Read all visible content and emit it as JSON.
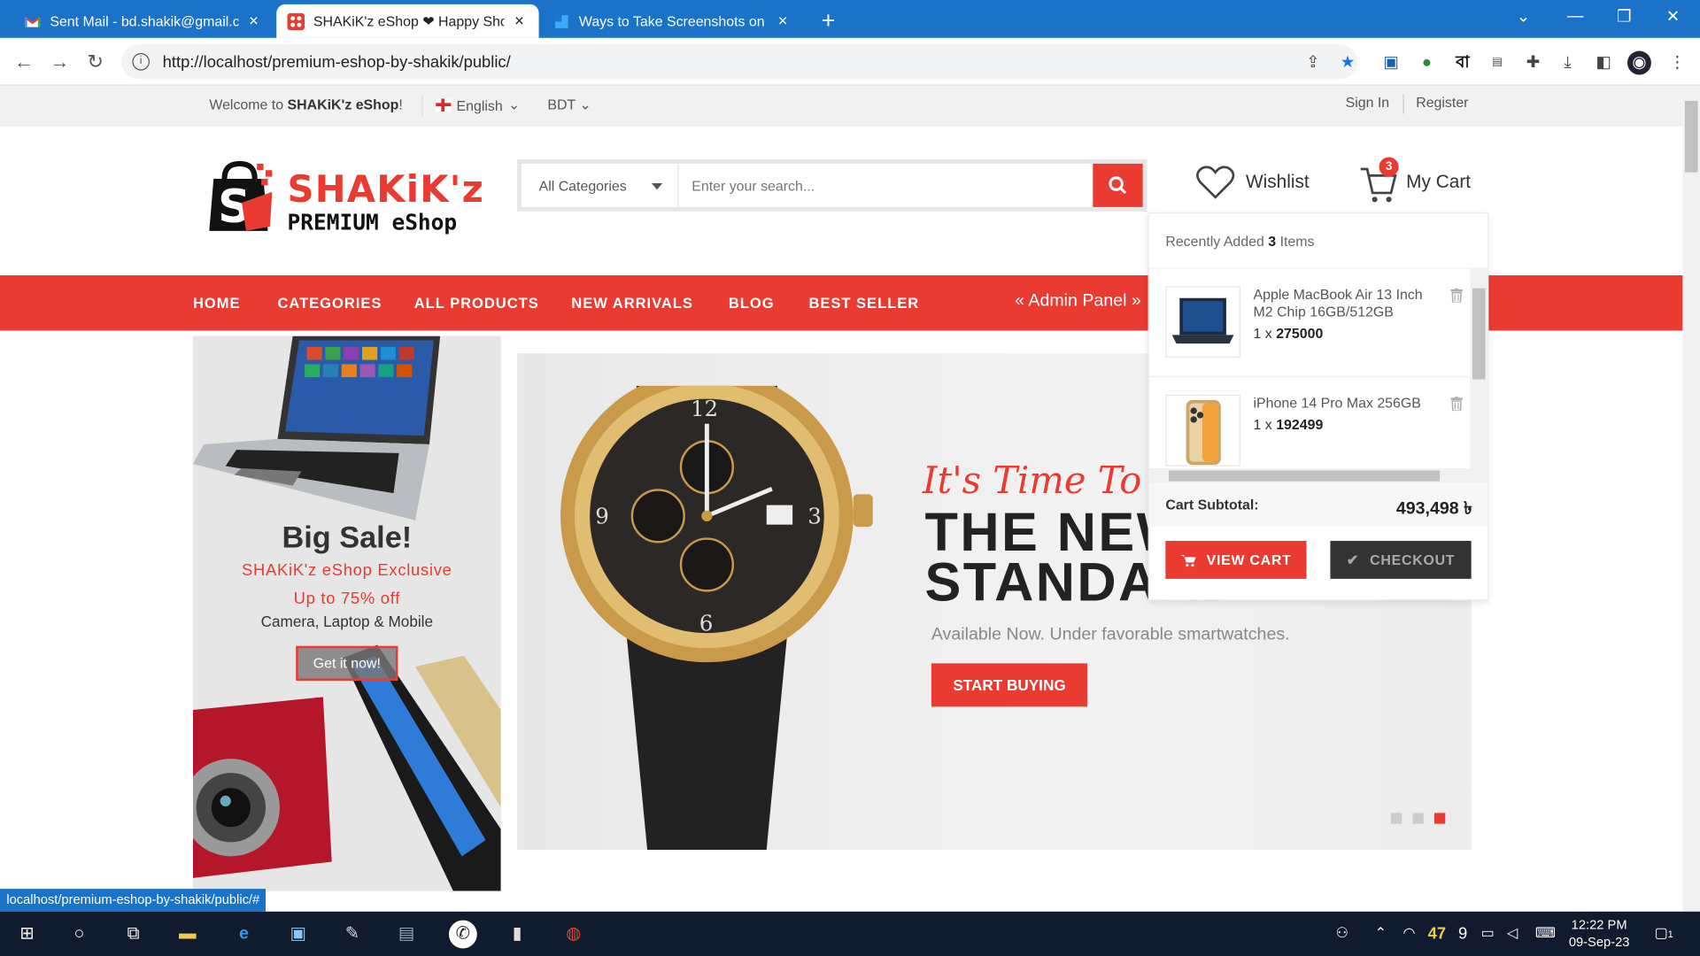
{
  "browser": {
    "tabs": [
      {
        "title": "Sent Mail - bd.shakik@gmail.con",
        "close": "×"
      },
      {
        "title": "SHAKiK'z eShop ❤ Happy Shoppi",
        "close": "×"
      },
      {
        "title": "Ways to Take Screenshots on Win",
        "close": "×"
      }
    ],
    "new_tab": "+",
    "url": "http://localhost/premium-eshop-by-shakik/public/",
    "status_url": "localhost/premium-eshop-by-shakik/public/#",
    "ext_bn_label": "বা"
  },
  "topbar": {
    "welcome_prefix": "Welcome to ",
    "welcome_brand": "SHAKiK'z eShop",
    "welcome_suffix": "!",
    "language": "English",
    "currency": "BDT",
    "sign_in": "Sign In",
    "register": "Register"
  },
  "logo": {
    "line1": "SHAKiK'z",
    "line2": "PREMIUM eShop"
  },
  "search": {
    "category": "All Categories",
    "placeholder": "Enter your search..."
  },
  "wishlist": {
    "label": "Wishlist"
  },
  "cart": {
    "label": "My Cart",
    "count": "3"
  },
  "nav": {
    "items": [
      "HOME",
      "CATEGORIES",
      "ALL PRODUCTS",
      "NEW ARRIVALS",
      "BLOG",
      "BEST SELLER"
    ],
    "admin": "« Admin Panel »"
  },
  "side_banner": {
    "title": "Big Sale!",
    "line1": "SHAKiK'z eShop Exclusive",
    "line2": "Up to 75% off",
    "line3": "Camera, Laptop & Mobile",
    "button": "Get it now!"
  },
  "slider": {
    "script_text": "It's Time To Look",
    "headline_1": "THE NEW",
    "headline_2": "STANDARD",
    "subtitle": "Available Now. Under favorable smartwatches.",
    "button": "START BUYING",
    "active_dot": 3,
    "dot_count": 3
  },
  "cart_dropdown": {
    "recent_prefix": "Recently Added ",
    "recent_count": "3",
    "recent_suffix": " Items",
    "items": [
      {
        "name": "Apple MacBook Air 13 Inch M2 Chip 16GB/512GB",
        "qty": "1",
        "price": "275000"
      },
      {
        "name": "iPhone 14 Pro Max 256GB",
        "qty": "1",
        "price": "192499"
      }
    ],
    "qty_sep": " x ",
    "subtotal_label": "Cart Subtotal:",
    "subtotal_value": "493,498 ৳",
    "view_cart": "VIEW CART",
    "checkout": "CHECKOUT"
  },
  "taskbar": {
    "temperature": "47",
    "tray_num": "9",
    "time": "12:22 PM",
    "date": "09-Sep-23",
    "notif_count": "1"
  },
  "colors": {
    "accent": "#e93b31",
    "chrome": "#1a73c8",
    "taskbar": "#101b2e"
  }
}
